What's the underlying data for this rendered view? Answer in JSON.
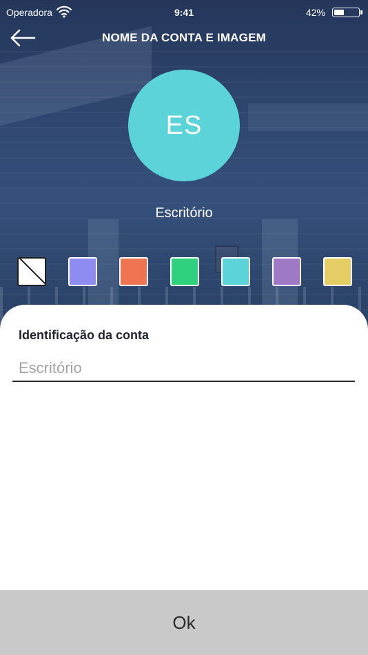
{
  "status_bar": {
    "carrier": "Operadora",
    "time": "9:41",
    "battery_percent": "42%",
    "battery_level": 0.42,
    "wifi_icon": "wifi-icon",
    "battery_icon": "battery-icon"
  },
  "nav": {
    "title": "NOME DA CONTA E IMAGEM",
    "back_icon": "arrow-left-icon"
  },
  "avatar": {
    "initials": "ES",
    "color": "#5cd3d8"
  },
  "account": {
    "name": "Escritório"
  },
  "colors": {
    "options": [
      {
        "name": "none",
        "hex": "#ffffff"
      },
      {
        "name": "lavender",
        "hex": "#8e8cf0"
      },
      {
        "name": "orange",
        "hex": "#ef7451"
      },
      {
        "name": "green",
        "hex": "#2fd07e"
      },
      {
        "name": "cyan",
        "hex": "#5cd3d8"
      },
      {
        "name": "purple",
        "hex": "#a079c5"
      },
      {
        "name": "yellow",
        "hex": "#e4cd64"
      }
    ],
    "header_background": "#2f4770"
  },
  "form": {
    "label": "Identificação da conta",
    "value": "",
    "placeholder": "Escritório"
  },
  "footer": {
    "ok_label": "Ok"
  }
}
